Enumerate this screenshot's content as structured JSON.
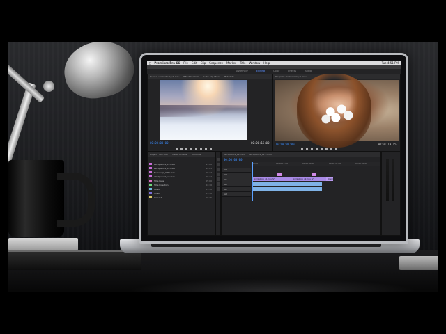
{
  "app": {
    "menubar_items": [
      "Premiere Pro CC",
      "File",
      "Edit",
      "Clip",
      "Sequence",
      "Marker",
      "Title",
      "Window",
      "Help"
    ],
    "clock": "Tue 4:51 PM"
  },
  "workspaces": [
    "Assembly",
    "Editing",
    "Color",
    "Effects",
    "Audio"
  ],
  "active_workspace": "Editing",
  "source_monitor": {
    "tabs": [
      "Source: skiclipstock_v1.mov",
      "Effect Controls",
      "Audio Clip Mixer",
      "Metadata"
    ],
    "timecode_in": "00:00:00:00",
    "timecode_out": "00:00:15:00",
    "zoom": "Fit",
    "scene": "snowy-mountain-skiers"
  },
  "program_monitor": {
    "tabs": [
      "Program: skiclipstock_v1.mov"
    ],
    "timecode_in": "00:00:00:00",
    "timecode_out": "00:01:10:15",
    "zoom": "Fit",
    "scene": "woman-with-white-flowers"
  },
  "project_panel": {
    "tabs": [
      "Project: Title stuff",
      "Media Browser",
      "Libraries",
      "Info"
    ],
    "items": [
      {
        "name": "skiclipstock_v1.mov",
        "swatch": "#c86dd8",
        "dur": "15:00"
      },
      {
        "name": "skiclipstock_v2.mov",
        "swatch": "#c86dd8",
        "dur": "12:05"
      },
      {
        "name": "flowerclip_UHD.mov",
        "swatch": "#c86dd8",
        "dur": "18:14"
      },
      {
        "name": "skiclipstock_v3.mov",
        "swatch": "#c86dd8",
        "dur": "09:12"
      },
      {
        "name": "Title Page",
        "swatch": "#d86dc0",
        "dur": "05:00"
      },
      {
        "name": "Title Insertion",
        "swatch": "#6dd87a",
        "dur": "04:10"
      },
      {
        "name": "Music",
        "swatch": "#6db8d8",
        "dur": "01:10"
      },
      {
        "name": "Video",
        "swatch": "#7a6dd8",
        "dur": "01:10"
      },
      {
        "name": "Video 2",
        "swatch": "#d8c86d",
        "dur": "00:45"
      }
    ]
  },
  "timeline": {
    "tabs": [
      "skiclipstock_v1.mov",
      "skiclipstock_v1 2.mov"
    ],
    "timecode": "00:00:00:00",
    "ruler_labels": [
      "00:00",
      "00:00:15:00",
      "00:00:30:00",
      "00:00:45:00",
      "00:01:00:00"
    ],
    "tracks": [
      "V3",
      "V2",
      "V1",
      "A1",
      "A2",
      "A3"
    ],
    "video_clips": [
      {
        "label": "skiclipstock_v1.mov [V]",
        "color": "#a98ae6"
      },
      {
        "label": "skiclipstock_v2.mov [V]",
        "color": "#a98ae6"
      },
      {
        "label": "flowerclip_UHD.mov [V]",
        "color": "#b99af0"
      }
    ],
    "audio_clips": [
      {
        "label": "",
        "color": "#7fb2e6"
      },
      {
        "label": "",
        "color": "#7fb2e6"
      }
    ]
  },
  "colors": {
    "accent": "#3a8cff",
    "panel_bg": "#232325",
    "video_clip": "#a98ae6",
    "audio_clip": "#7fb2e6"
  }
}
